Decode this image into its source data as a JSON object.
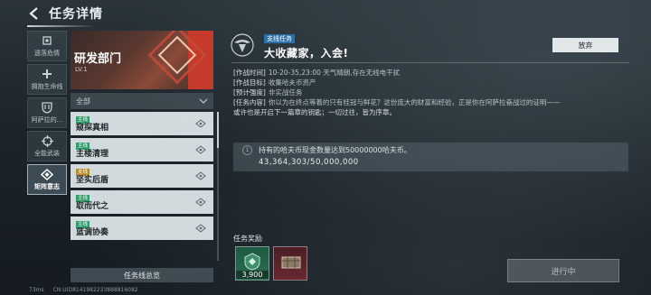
{
  "header": {
    "title": "任务详情"
  },
  "nav": [
    {
      "label": "遗落危情",
      "icon": "cube-icon"
    },
    {
      "label": "拥抱生命线",
      "icon": "plus-icon"
    },
    {
      "label": "阿萨拉的...",
      "icon": "shield-icon"
    },
    {
      "label": "全能武装",
      "icon": "crosshair-icon"
    },
    {
      "label": "矩阵意志",
      "icon": "diamond-icon",
      "active": true
    }
  ],
  "department": {
    "name": "研发部门",
    "level": "LV.1"
  },
  "filter": {
    "label": "全部"
  },
  "quests": [
    {
      "tag": "主线",
      "name": "窥探真相",
      "tag_color": "#2e9e6a"
    },
    {
      "tag": "主线",
      "name": "主楼清理",
      "tag_color": "#2e9e6a"
    },
    {
      "tag": "支线",
      "name": "坚实后盾",
      "tag_color": "#b6892d"
    },
    {
      "tag": "主线",
      "name": "取而代之",
      "tag_color": "#2e9e6a"
    },
    {
      "tag": "主线",
      "name": "蓝调协奏",
      "tag_color": "#2e9e6a"
    }
  ],
  "list_footer": "任务线总览",
  "detail": {
    "tag": "支线任务",
    "title": "大收藏家，入会!",
    "abandon": "放弃",
    "info": [
      {
        "k": "[作战时间]",
        "v": "10-20-35,23:00 天气晴朗,存在无线电干扰"
      },
      {
        "k": "[作战目标]",
        "v": "收集哈夫币资产"
      },
      {
        "k": "[预计强度]",
        "v": "非实战任务"
      },
      {
        "k": "[任务内容]",
        "v": "你以为在终点等着的只有桂冠与鲜花？这份庞大的财富和经验，正是你在阿萨拉奋战过的证明——"
      }
    ],
    "info_cont": "或许也是开启下一篇章的钥匙；一切过往，皆为序章。",
    "condition": {
      "index": "1",
      "text": "持有的哈夫币现金数量达到50000000哈夫币。",
      "progress": "43,364,303/50,000,000",
      "current": 43364303,
      "target": 50000000
    },
    "reward_title": "任务奖励",
    "rewards": [
      {
        "qty": "3,900",
        "icon": "badge-icon"
      },
      {
        "qty": "",
        "icon": "crate-icon"
      }
    ],
    "status_button": "进行中"
  },
  "footer": {
    "ping": "73ms",
    "uid": "CN:UID8141982233888816082"
  }
}
